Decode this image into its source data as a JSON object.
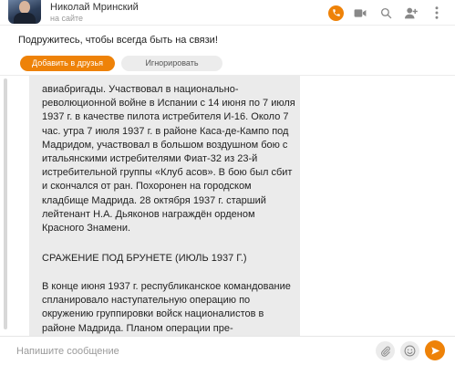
{
  "header": {
    "user_name": "Николай Мринский",
    "user_status": "на сайте"
  },
  "notice": {
    "text": "Подружитесь, чтобы всегда быть на связи!",
    "add_friend_label": "Добавить в друзья",
    "ignore_label": "Игнорировать"
  },
  "message": {
    "paragraphs": [
      "авиабригады. Участвовал  в  национально-революционной  войне  в  Испании с 14 июня по 7 июля 1937 г. в качестве пилота истребителя И-16. Около 7 час. утра 7 июля 1937 г. в районе Каса-де-Кампо под Мадридом, участвовал в большом воздушном бою с итальянскими истребителями Фиат-32 из 23-й истребительной группы «Клуб асов». В бою был сбит и скончался от ран. Похоронен на городском кладбище Мадрида. 28 октября 1937 г. старший лейтенант Н.А. Дьяконов награждён орденом Красного Знамени.",
      "СРАЖЕНИЕ ПОД БРУНЕТЕ (ИЮЛЬ 1937 Г.)",
      "В конце июня 1937 г. республиканское командование спланировало наступательную операцию по окружению группировки войск националистов в районе Мадрида. Планом операции пре-"
    ]
  },
  "composer": {
    "placeholder": "Напишите сообщение"
  },
  "colors": {
    "accent": "#ee8208",
    "bubble": "#ebebeb"
  },
  "icons": [
    "phone-icon",
    "video-icon",
    "search-icon",
    "add-user-icon",
    "more-icon",
    "paperclip-icon",
    "smile-icon",
    "send-icon"
  ]
}
